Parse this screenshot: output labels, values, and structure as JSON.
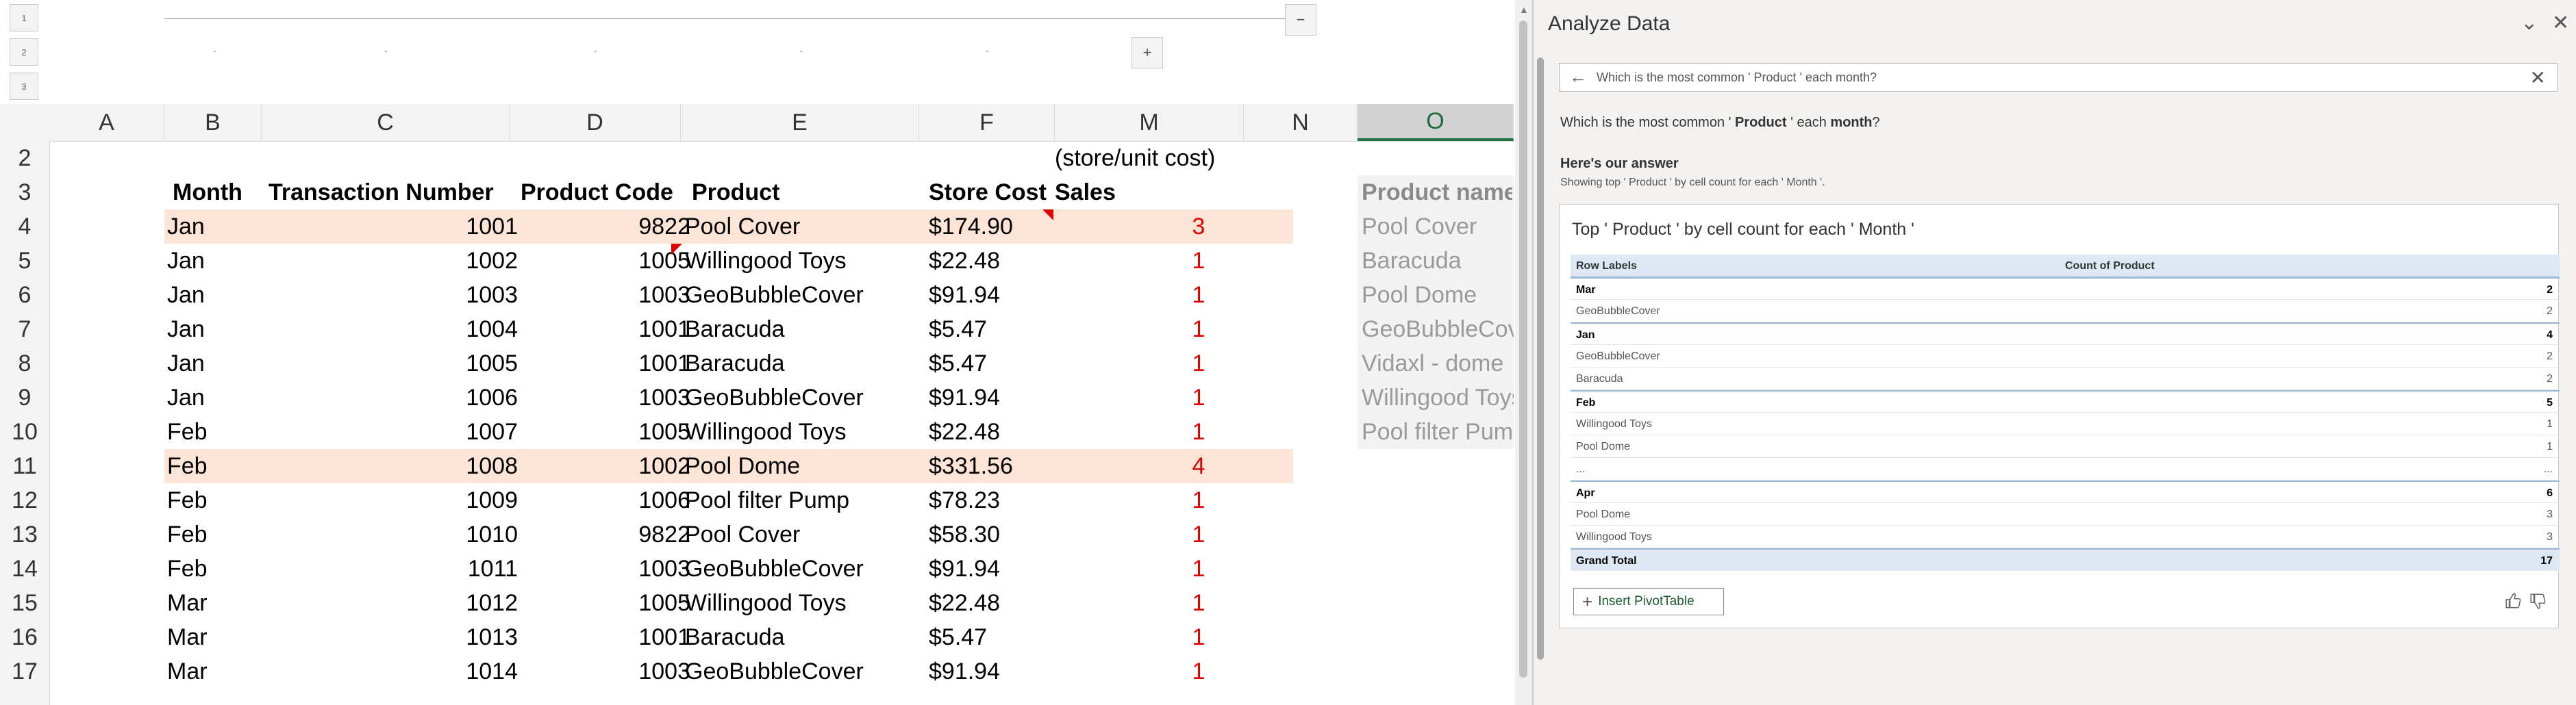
{
  "outline": {
    "levels": [
      "1",
      "2",
      "3"
    ],
    "collapse_symbol": "−",
    "expand_symbol": "+"
  },
  "columns": [
    "A",
    "B",
    "C",
    "D",
    "E",
    "F",
    "M",
    "N",
    "O"
  ],
  "selected_column": "O",
  "row_numbers": [
    "2",
    "3",
    "4",
    "5",
    "6",
    "7",
    "8",
    "9",
    "10",
    "11",
    "12",
    "13",
    "14",
    "15",
    "16",
    "17"
  ],
  "sheet": {
    "row2": {
      "m_header": "(store/unit cost)"
    },
    "headers": {
      "month": "Month",
      "transaction": "Transaction Number",
      "product_code": "Product Code",
      "product": "Product",
      "store_cost": "Store Cost",
      "sales": "Sales",
      "product_name": "Product name"
    },
    "rows": [
      {
        "month": "Jan",
        "txn": "1001",
        "code": "9822",
        "product": "Pool Cover",
        "cost": "$174.90",
        "sales": "3",
        "side": "Pool Cover"
      },
      {
        "month": "Jan",
        "txn": "1002",
        "code": "1005",
        "product": "Willingood Toys",
        "cost": "$22.48",
        "sales": "1",
        "side": "Baracuda"
      },
      {
        "month": "Jan",
        "txn": "1003",
        "code": "1003",
        "product": "GeoBubbleCover",
        "cost": "$91.94",
        "sales": "1",
        "side": "Pool Dome"
      },
      {
        "month": "Jan",
        "txn": "1004",
        "code": "1001",
        "product": "Baracuda",
        "cost": "$5.47",
        "sales": "1",
        "side": "GeoBubbleCover"
      },
      {
        "month": "Jan",
        "txn": "1005",
        "code": "1001",
        "product": "Baracuda",
        "cost": "$5.47",
        "sales": "1",
        "side": "Vidaxl - dome"
      },
      {
        "month": "Jan",
        "txn": "1006",
        "code": "1003",
        "product": "GeoBubbleCover",
        "cost": "$91.94",
        "sales": "1",
        "side": "Willingood Toys"
      },
      {
        "month": "Feb",
        "txn": "1007",
        "code": "1005",
        "product": "Willingood Toys",
        "cost": "$22.48",
        "sales": "1",
        "side": "Pool filter Pump"
      },
      {
        "month": "Feb",
        "txn": "1008",
        "code": "1002",
        "product": "Pool Dome",
        "cost": "$331.56",
        "sales": "4",
        "side": ""
      },
      {
        "month": "Feb",
        "txn": "1009",
        "code": "1006",
        "product": "Pool filter Pump",
        "cost": "$78.23",
        "sales": "1",
        "side": ""
      },
      {
        "month": "Feb",
        "txn": "1010",
        "code": "9822",
        "product": "Pool Cover",
        "cost": "$58.30",
        "sales": "1",
        "side": ""
      },
      {
        "month": "Feb",
        "txn": "1011",
        "code": "1003",
        "product": "GeoBubbleCover",
        "cost": "$91.94",
        "sales": "1",
        "side": ""
      },
      {
        "month": "Mar",
        "txn": "1012",
        "code": "1005",
        "product": "Willingood Toys",
        "cost": "$22.48",
        "sales": "1",
        "side": ""
      },
      {
        "month": "Mar",
        "txn": "1013",
        "code": "1001",
        "product": "Baracuda",
        "cost": "$5.47",
        "sales": "1",
        "side": ""
      },
      {
        "month": "Mar",
        "txn": "1014",
        "code": "1003",
        "product": "GeoBubbleCover",
        "cost": "$91.94",
        "sales": "1",
        "side": ""
      }
    ]
  },
  "pane": {
    "title": "Analyze Data",
    "collapse_icon": "chevron-down-icon",
    "close_icon": "close-icon",
    "search_query": "Which is the most common ' Product ' each month?",
    "question_parts": [
      "Which is the most common ' ",
      "Product",
      " ' each ",
      "month",
      "?"
    ],
    "answer_title": "Here's our answer",
    "answer_subtitle": "Showing top ' Product ' by cell count for each ' Month '.",
    "card_title": "Top ' Product ' by cell count for each ' Month '",
    "pivot": {
      "headers": [
        "Row Labels",
        "Count of Product"
      ],
      "rows": [
        {
          "label": "Mar",
          "count": "2",
          "type": "group"
        },
        {
          "label": "GeoBubbleCover",
          "count": "2",
          "type": "item"
        },
        {
          "label": "Jan",
          "count": "4",
          "type": "group"
        },
        {
          "label": "GeoBubbleCover",
          "count": "2",
          "type": "item"
        },
        {
          "label": "Baracuda",
          "count": "2",
          "type": "item"
        },
        {
          "label": "Feb",
          "count": "5",
          "type": "group"
        },
        {
          "label": "Willingood Toys",
          "count": "1",
          "type": "item"
        },
        {
          "label": "Pool Dome",
          "count": "1",
          "type": "item"
        },
        {
          "label": "...",
          "count": "...",
          "type": "item"
        },
        {
          "label": "Apr",
          "count": "6",
          "type": "group"
        },
        {
          "label": "Pool Dome",
          "count": "3",
          "type": "item"
        },
        {
          "label": "Willingood Toys",
          "count": "3",
          "type": "item"
        },
        {
          "label": "Grand Total",
          "count": "17",
          "type": "total"
        }
      ]
    },
    "insert_button": "Insert PivotTable",
    "feedback_icons": [
      "thumbs-up-icon",
      "thumbs-down-icon"
    ]
  },
  "colors": {
    "highlight_row": "#fce4d6",
    "sales_red": "#e00000",
    "excel_green": "#217346",
    "pivot_header": "#dde8f3"
  }
}
